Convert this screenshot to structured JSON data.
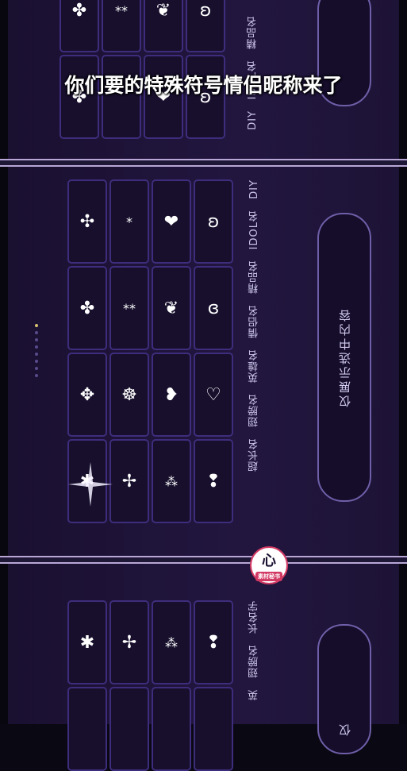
{
  "caption": "你们要的特殊符号情侣昵称来了",
  "top_panel": {
    "rows": [
      [
        "✤",
        "**",
        "❦",
        "ʚ"
      ],
      [
        "✤",
        "",
        "❤",
        "ʚ"
      ]
    ],
    "tabs": [
      "精品名",
      "IDOL名",
      "DIY"
    ]
  },
  "main_panel": {
    "tabs": [
      "DIY",
      "IDOL名",
      "精品名",
      "情侣名",
      "英雄名",
      "翅膀名",
      "超长名"
    ],
    "grid": [
      [
        "✣",
        "*",
        "❤",
        "ʚ"
      ],
      [
        "✤",
        "**",
        "❦",
        "ɞ"
      ],
      [
        "✥",
        "☸",
        "❥",
        "♡"
      ],
      [
        "✱",
        "✢",
        "⁂",
        "❢"
      ]
    ],
    "pill_text": "仅展示选中内容"
  },
  "bottom_panel": {
    "tabs": [
      "长名字",
      "翅膀名",
      "英"
    ],
    "grid": [
      [
        "✱",
        "✢",
        "⁂",
        "❢"
      ],
      [
        "",
        "",
        "",
        ""
      ]
    ],
    "pill_text": "仅"
  },
  "logo": {
    "glyph": "心",
    "label": "素材秘书"
  },
  "colors": {
    "accent": "#3e2d7c",
    "frame": "#b8a7d6",
    "background": "#1c1235"
  }
}
